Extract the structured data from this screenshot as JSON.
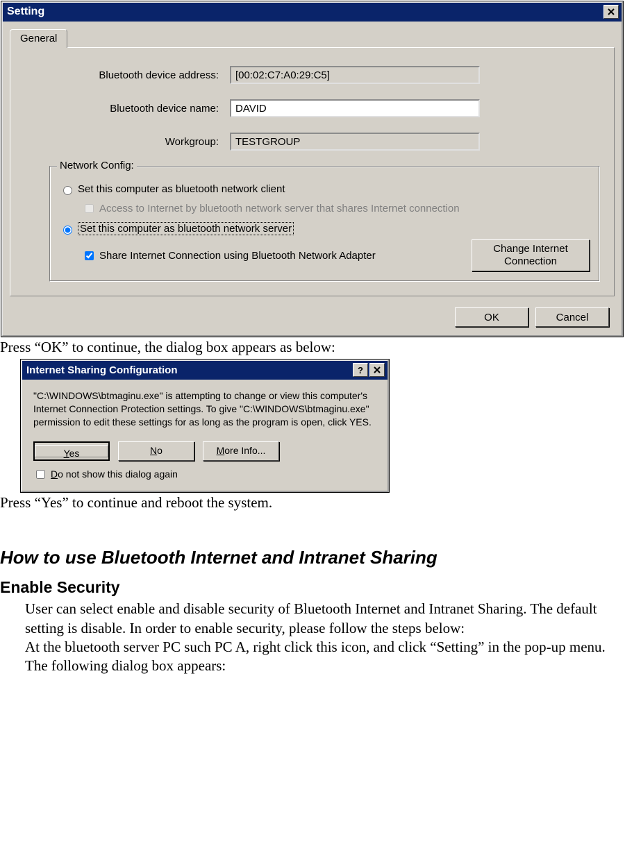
{
  "setting_dialog": {
    "title": "Setting",
    "tab_general": "General",
    "label_address": "Bluetooth device address:",
    "value_address": "[00:02:C7:A0:29:C5]",
    "label_name": "Bluetooth device name:",
    "value_name": "DAVID",
    "label_workgroup": "Workgroup:",
    "value_workgroup": "TESTGROUP",
    "group_legend": "Network Config:",
    "radio_client": "Set this computer as bluetooth network client",
    "check_access": "Access to Internet by bluetooth network server that shares Internet connection",
    "radio_server": "Set this computer as bluetooth network server",
    "check_share": "Share Internet Connection using Bluetooth Network Adapter",
    "btn_change": "Change Internet Connection",
    "btn_ok": "OK",
    "btn_cancel": "Cancel"
  },
  "doc": {
    "press_ok": "Press “OK” to continue, the dialog box appears as below:",
    "press_yes": "Press “Yes” to continue and reboot the system.",
    "h1": "How to use Bluetooth Internet and Intranet Sharing",
    "h2": "Enable Security",
    "para1": "User can select enable and disable security of Bluetooth Internet and Intranet Sharing. The default setting is disable. In order to enable security, please follow the steps below:",
    "para2": "At the bluetooth server PC such PC A, right click this icon, and click “Setting” in the pop-up menu. The following dialog  box appears:"
  },
  "isc_dialog": {
    "title": "Internet Sharing Configuration",
    "body": "\"C:\\WINDOWS\\btmaginu.exe\" is attempting to change or view this computer's Internet Connection Protection settings. To give \"C:\\WINDOWS\\btmaginu.exe\" permission to edit these settings for as long as the program is open, click YES.",
    "btn_yes": "Yes",
    "btn_no": "No",
    "btn_more": "More Info...",
    "check_label_prefix": "D",
    "check_label_rest": "o not show this dialog again"
  }
}
